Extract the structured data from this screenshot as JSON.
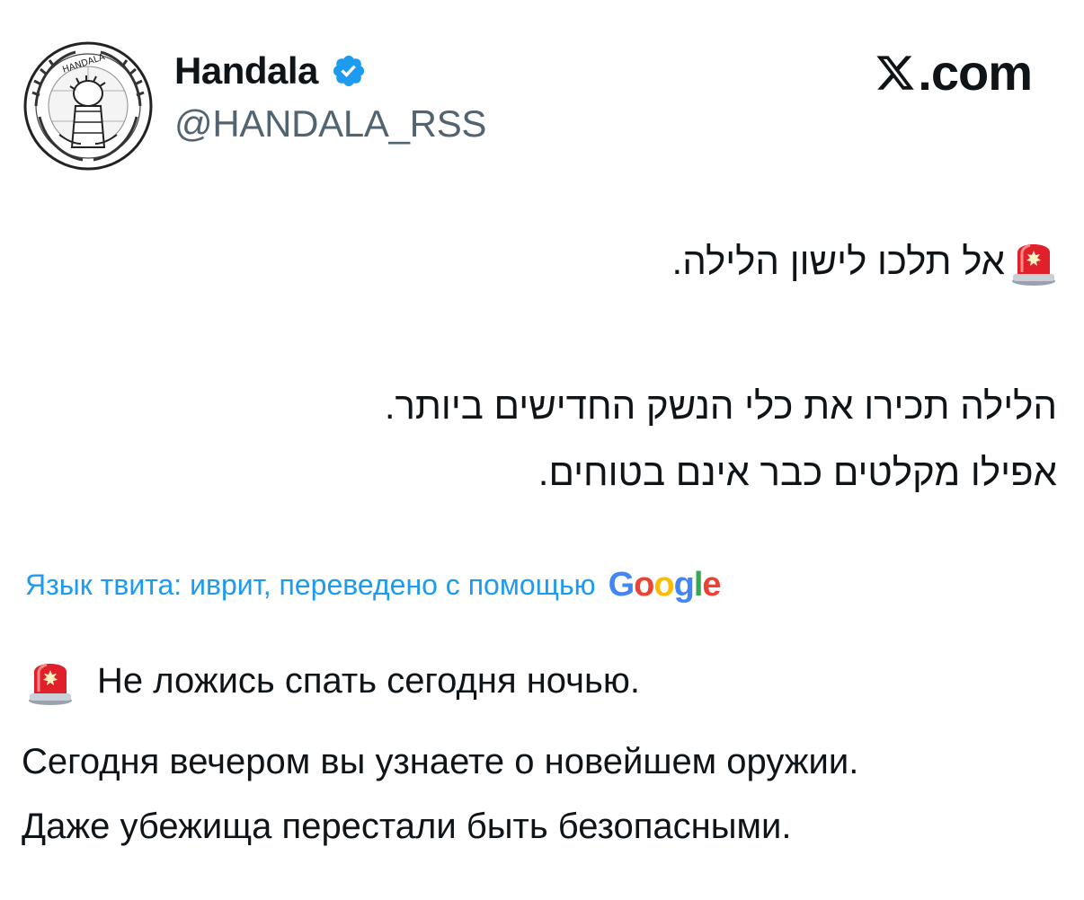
{
  "author": {
    "display_name": "Handala",
    "handle": "@HANDALA_RSS",
    "avatar_text": "HANDALA"
  },
  "brand": {
    "suffix": ".com"
  },
  "tweet": {
    "hebrew_lines": [
      "אל תלכו לישון הלילה.",
      "הלילה תכירו את כלי הנשק החדישים ביותר.",
      "אפילו מקלטים כבר אינם בטוחים."
    ]
  },
  "translation": {
    "label": "Язык твита: иврит, переведено с помощью",
    "provider": "Google",
    "lines": [
      "Не ложись спать сегодня ночью.",
      "Сегодня вечером вы узнаете о новейшем оружии.",
      "Даже убежища перестали быть безопасными."
    ]
  },
  "icons": {
    "verified": "verified-badge-icon",
    "siren": "police-siren-icon",
    "x_logo": "x-logo-icon"
  },
  "colors": {
    "verified_blue": "#1d9bf0",
    "link_blue": "#1d9bf0",
    "handle_gray": "#536471",
    "siren_red": "#e0202a"
  }
}
